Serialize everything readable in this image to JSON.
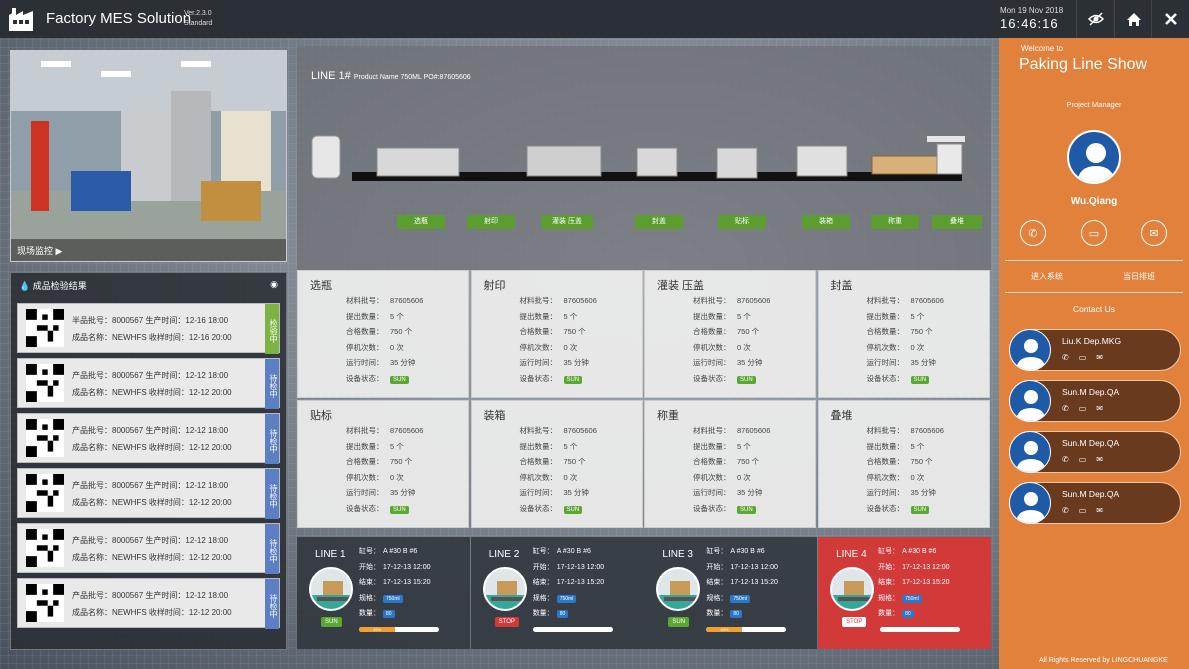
{
  "app": {
    "title": "Factory MES Solution",
    "version": "Ver.2.3.0",
    "edition": "Standard",
    "date": "Mon 19 Nov 2018",
    "time": "16:46:16"
  },
  "toolbar": {
    "icons": [
      "eye-icon",
      "home-icon",
      "close-icon"
    ]
  },
  "monitor": {
    "label": "现场监控 ▶"
  },
  "inspection": {
    "title": "成品检验结果",
    "cards": [
      {
        "l1": "半品批号：8000567  生产时间：12-16 18:00",
        "l2": "成品名称：NEWHFS  收样时间：12-16 20:00",
        "tag": "检验中",
        "color": "#7cb342"
      },
      {
        "l1": "产品批号：8000567  生产时间：12-12 18:00",
        "l2": "成品名称：NEWHFS  收样时间：12-12 20:00",
        "tag": "待检中",
        "color": "#5c7fc4"
      },
      {
        "l1": "产品批号：8000567  生产时间：12-12 18:00",
        "l2": "成品名称：NEWHFS  收样时间：12-12 20:00",
        "tag": "待检中",
        "color": "#5c7fc4"
      },
      {
        "l1": "产品批号：8000567  生产时间：12-12 18:00",
        "l2": "成品名称：NEWHFS  收样时间：12-12 20:00",
        "tag": "待检中",
        "color": "#5c7fc4"
      },
      {
        "l1": "产品批号：8000567  生产时间：12-12 18:00",
        "l2": "成品名称：NEWHFS  收样时间：12-12 20:00",
        "tag": "待检中",
        "color": "#5c7fc4"
      },
      {
        "l1": "产品批号：8000567  生产时间：12-12 18:00",
        "l2": "成品名称：NEWHFS  收样时间：12-12 20:00",
        "tag": "待检中",
        "color": "#5c7fc4"
      }
    ]
  },
  "line1": {
    "title": "LINE 1#",
    "product": "Product Name 750ML  PO#:87605606",
    "stages": [
      "选瓶",
      "射印",
      "灌装 压盖",
      "封盖",
      "贴标",
      "装箱",
      "称重",
      "叠堆"
    ]
  },
  "stations": [
    {
      "name": "选瓶",
      "batch": "87605606",
      "out": "5 个",
      "ok": "750 个",
      "stops": "0 次",
      "run": "35 分钟",
      "state": "SUN"
    },
    {
      "name": "射印",
      "batch": "87605606",
      "out": "5 个",
      "ok": "750 个",
      "stops": "0 次",
      "run": "35 分钟",
      "state": "SUN"
    },
    {
      "name": "灌装 压盖",
      "batch": "87605606",
      "out": "5 个",
      "ok": "750 个",
      "stops": "0 次",
      "run": "35 分钟",
      "state": "SUN"
    },
    {
      "name": "封盖",
      "batch": "87605606",
      "out": "5 个",
      "ok": "750 个",
      "stops": "0 次",
      "run": "35 分钟",
      "state": "SUN"
    },
    {
      "name": "贴标",
      "batch": "87605606",
      "out": "5 个",
      "ok": "750 个",
      "stops": "0 次",
      "run": "35 分钟",
      "state": "SUN"
    },
    {
      "name": "装箱",
      "batch": "87605606",
      "out": "5 个",
      "ok": "750 个",
      "stops": "0 次",
      "run": "35 分钟",
      "state": "SUN"
    },
    {
      "name": "称重",
      "batch": "87605606",
      "out": "5 个",
      "ok": "750 个",
      "stops": "0 次",
      "run": "35 分钟",
      "state": "SUN"
    },
    {
      "name": "叠堆",
      "batch": "87605606",
      "out": "5 个",
      "ok": "750 个",
      "stops": "0 次",
      "run": "35 分钟",
      "state": "SUN"
    }
  ],
  "stationKeys": {
    "batch": "材料批号：",
    "out": "提出数量：",
    "ok": "合格数量：",
    "stops": "停机次数：",
    "run": "运行时间：",
    "state": "设备状态："
  },
  "lineKeys": {
    "vat": "缸号：",
    "start": "开始：",
    "end": "结束：",
    "spec": "规格：",
    "qty": "数量："
  },
  "lines": [
    {
      "name": "LINE 1",
      "vat": "A #30 B #6",
      "start": "17-12-13 12:00",
      "end": "17-12-13 15:20",
      "spec": "750ml",
      "qty": "80",
      "status": "SUN",
      "progress": 0.45,
      "progress_label": "45%"
    },
    {
      "name": "LINE 2",
      "vat": "A #30 B #6",
      "start": "17-12-13 12:00",
      "end": "17-12-13 15:20",
      "spec": "750ml",
      "qty": "80",
      "status": "STOP",
      "progress": 0,
      "progress_label": ""
    },
    {
      "name": "LINE 3",
      "vat": "A #30 B #6",
      "start": "17-12-13 12:00",
      "end": "17-12-13 15:20",
      "spec": "750ml",
      "qty": "80",
      "status": "SUN",
      "progress": 0.45,
      "progress_label": "45%"
    },
    {
      "name": "LINE 4",
      "vat": "A #30 B #6",
      "start": "17-12-13 12:00",
      "end": "17-12-13 15:20",
      "spec": "750ml",
      "qty": "80",
      "status": "STOP",
      "progress": 0,
      "progress_label": ""
    }
  ],
  "right": {
    "welcome": "Welcome to",
    "show": "Paking Line Show",
    "role": "Project Manager",
    "user": "Wu.Qiang",
    "links": [
      "进入系统",
      "当日排班"
    ],
    "contact_title": "Contact Us",
    "contacts": [
      {
        "name": "Liu.K    Dep.MKG"
      },
      {
        "name": "Sun.M    Dep.QA"
      },
      {
        "name": "Sun.M    Dep.QA"
      },
      {
        "name": "Sun.M    Dep.QA"
      }
    ],
    "footer": "All Rights Reserved by LINGCHUANGKE"
  },
  "colors": {
    "accent": "#e2813b",
    "ok": "#5aa832",
    "stop": "#d23a3a"
  }
}
